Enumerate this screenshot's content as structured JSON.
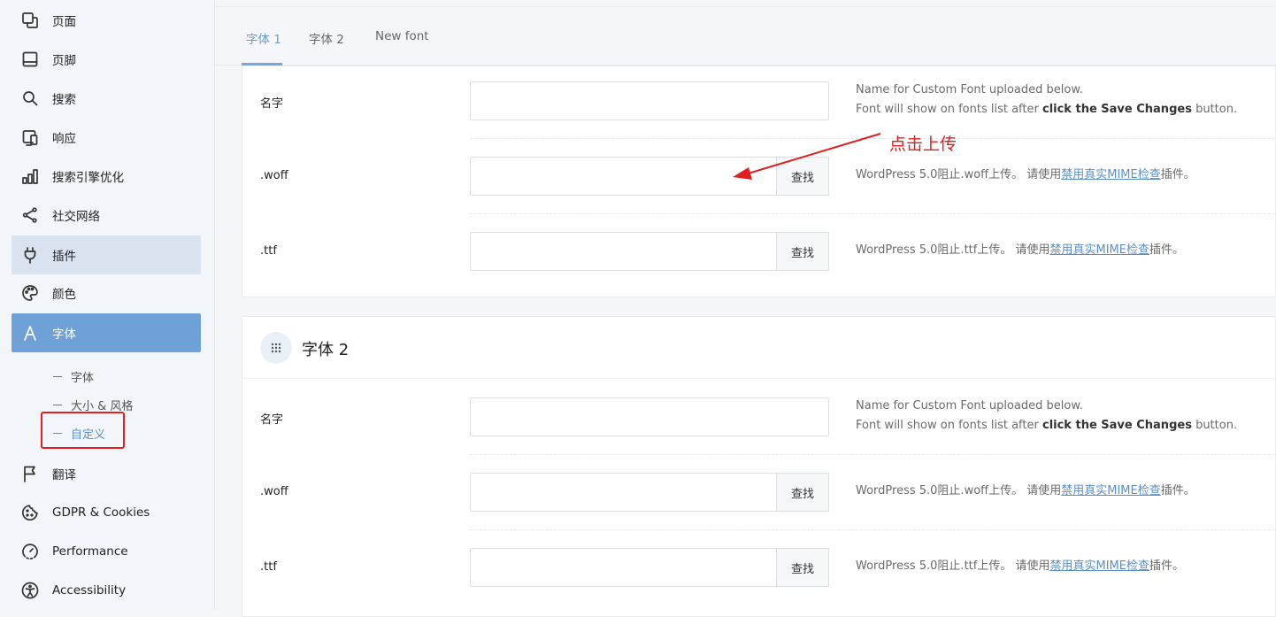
{
  "sidebar": {
    "items": [
      {
        "label": "页面",
        "icon": "pages-icon"
      },
      {
        "label": "页脚",
        "icon": "footer-icon"
      },
      {
        "label": "搜索",
        "icon": "search-icon"
      },
      {
        "label": "响应",
        "icon": "responsive-icon"
      },
      {
        "label": "搜索引擎优化",
        "icon": "seo-chart-icon"
      },
      {
        "label": "社交网络",
        "icon": "share-icon"
      },
      {
        "label": "插件",
        "icon": "plug-icon"
      },
      {
        "label": "颜色",
        "icon": "palette-icon"
      },
      {
        "label": "字体",
        "icon": "font-icon"
      },
      {
        "label": "翻译",
        "icon": "flag-icon"
      },
      {
        "label": "GDPR & Cookies",
        "icon": "cookie-icon"
      },
      {
        "label": "Performance",
        "icon": "speedometer-icon"
      },
      {
        "label": "Accessibility",
        "icon": "accessibility-icon"
      }
    ],
    "sub_items": [
      {
        "label": "字体"
      },
      {
        "label": "大小 & 风格"
      },
      {
        "label": "自定义"
      }
    ]
  },
  "tabs": [
    {
      "label": "字体 1"
    },
    {
      "label": "字体 2"
    },
    {
      "label": "New font"
    }
  ],
  "font1": {
    "name_label": "名字",
    "name_help_1": "Name for Custom Font uploaded below.",
    "name_help_2_pre": "Font will show on fonts list after ",
    "name_help_2_bold": "click the Save Changes",
    "name_help_2_post": " button.",
    "woff_label": ".woff",
    "woff_button": "查找",
    "woff_help_pre": "WordPress 5.0阻止.woff上传。 请使用",
    "woff_help_link": "禁用真实MIME检查",
    "woff_help_post": "插件。",
    "ttf_label": ".ttf",
    "ttf_button": "查找",
    "ttf_help_pre": "WordPress 5.0阻止.ttf上传。 请使用",
    "ttf_help_link": "禁用真实MIME检查",
    "ttf_help_post": "插件。"
  },
  "font2": {
    "title": "字体 2",
    "name_label": "名字",
    "name_help_1": "Name for Custom Font uploaded below.",
    "name_help_2_pre": "Font will show on fonts list after ",
    "name_help_2_bold": "click the Save Changes",
    "name_help_2_post": " button.",
    "woff_label": ".woff",
    "woff_button": "查找",
    "woff_help_pre": "WordPress 5.0阻止.woff上传。 请使用",
    "woff_help_link": "禁用真实MIME检查",
    "woff_help_post": "插件。",
    "ttf_label": ".ttf",
    "ttf_button": "查找",
    "ttf_help_pre": "WordPress 5.0阻止.ttf上传。 请使用",
    "ttf_help_link": "禁用真实MIME检查",
    "ttf_help_post": "插件。"
  },
  "annotation": {
    "text": "点击上传",
    "color": "#e02020"
  },
  "colors": {
    "accent": "#6fa0d6",
    "link": "#5b8fc7",
    "highlight": "#d8e3ef"
  }
}
